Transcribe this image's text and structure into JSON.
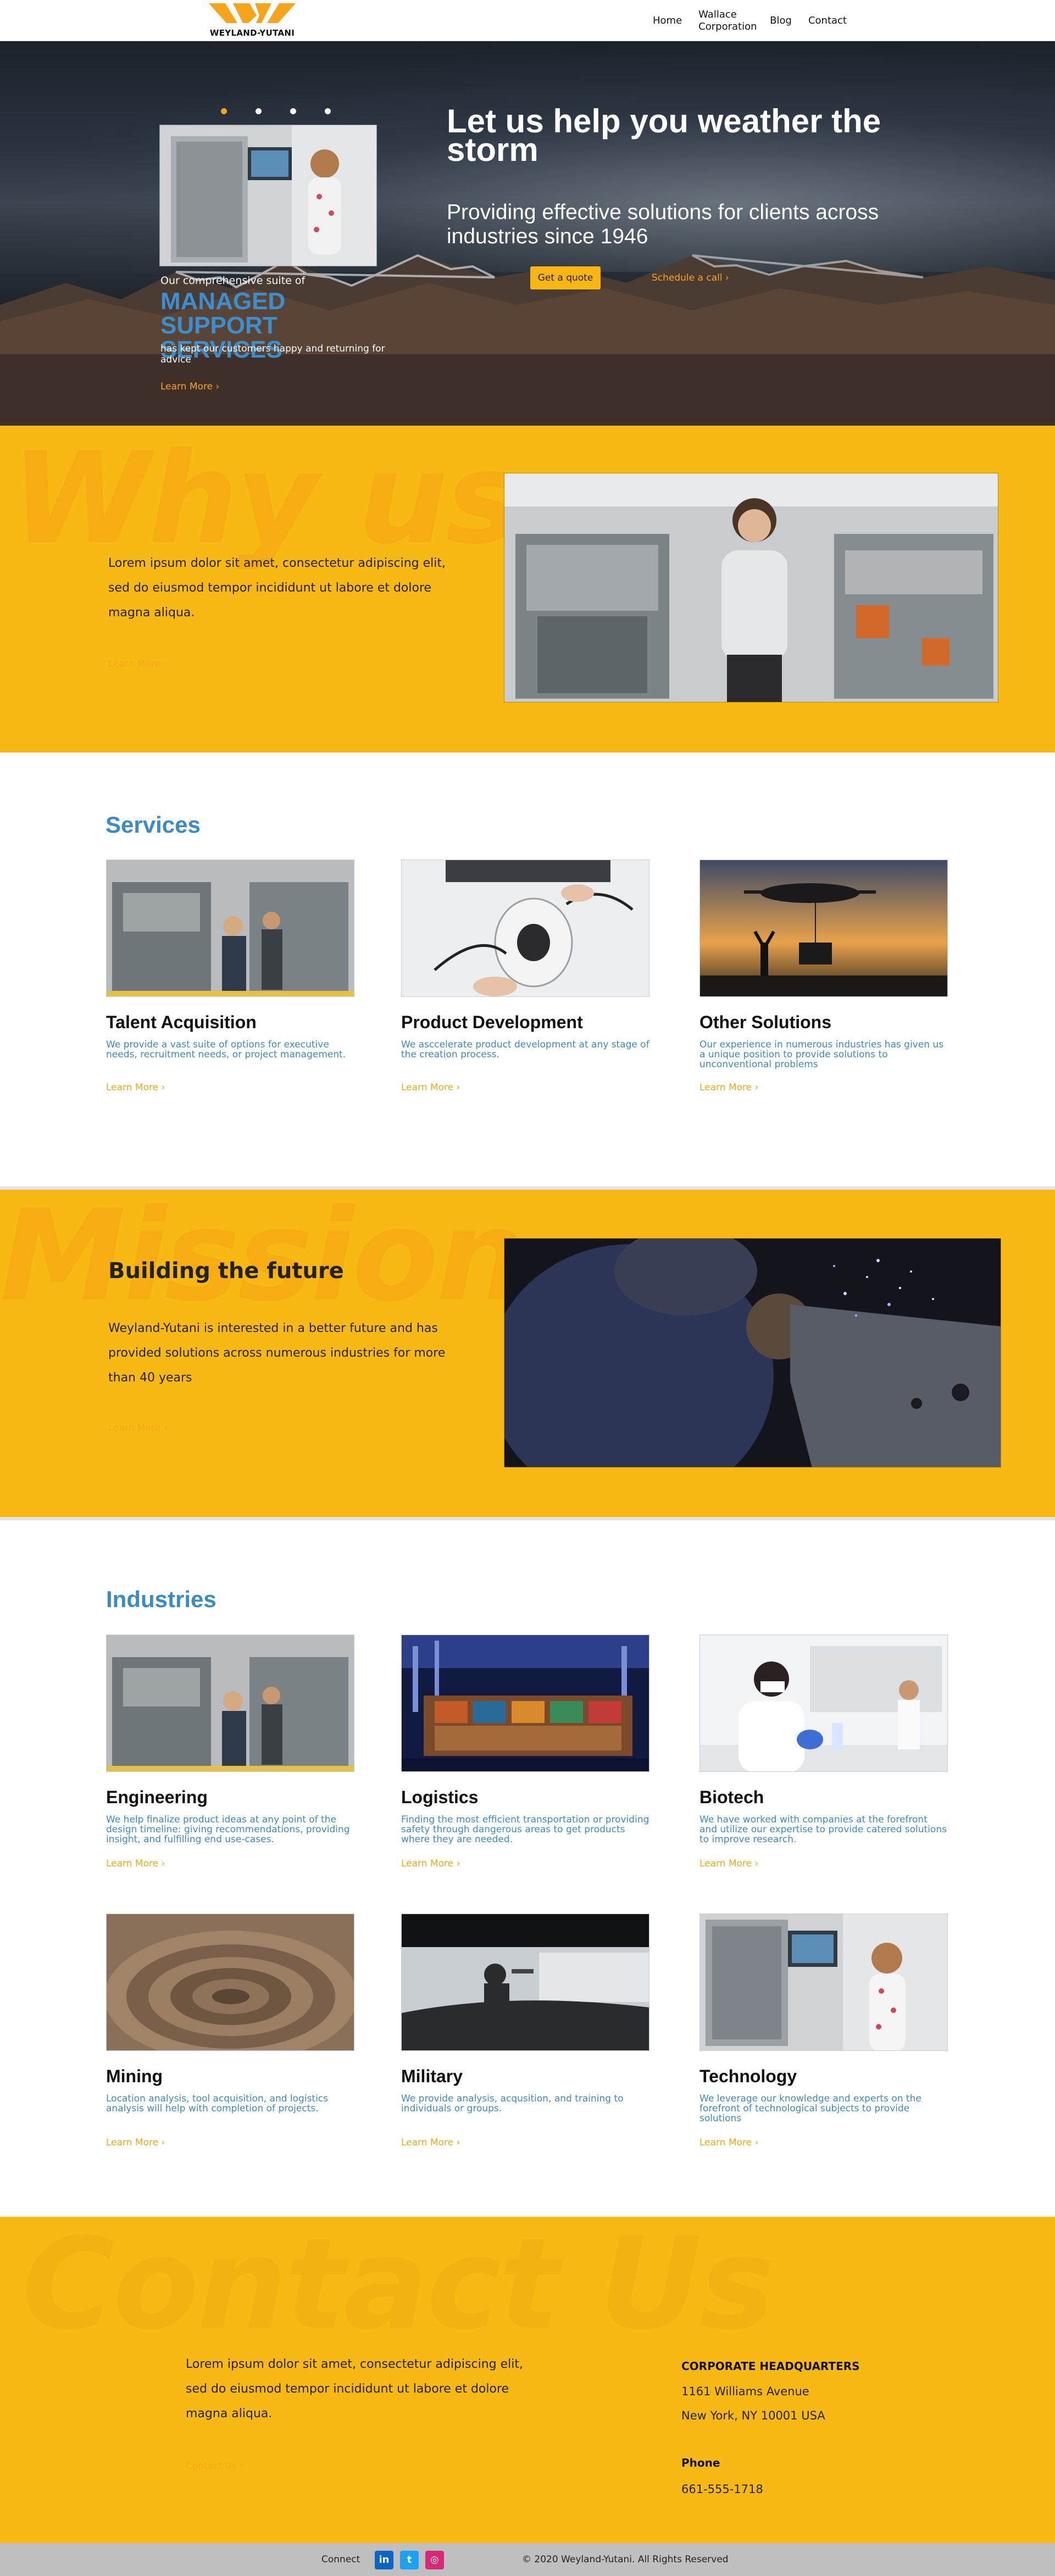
{
  "nav": {
    "logo_text": "WEYLAND-YUTANI",
    "links": [
      "Home",
      "Wallace Corporation",
      "Blog",
      "Contact"
    ]
  },
  "hero": {
    "slide_caption_top": "Our comprehensive suite of",
    "slide_highlight": "MANAGED SUPPORT SERVICES",
    "slide_caption_bottom": "has kept our customers happy and returning for advice",
    "slide_link": "Learn More",
    "title": "Let us help you weather the storm",
    "tagline": "Providing effective solutions for clients across industries since 1946",
    "quote_button": "Get a quote",
    "call_link": "Schedule a call"
  },
  "why_us": {
    "watermark": "Why us",
    "body": "Lorem ipsum dolor sit amet, consectetur adipiscing elit, sed do eiusmod tempor incididunt ut labore et dolore magna aliqua.",
    "link": "Learn More"
  },
  "services": {
    "title": "Services",
    "cards": [
      {
        "title": "Talent Acquisition",
        "desc": "We provide a vast suite of options for executive needs, recruitment needs, or project management.",
        "link": "Learn More"
      },
      {
        "title": "Product Development",
        "desc": "We asccelerate product development at any stage of the creation process.",
        "link": "Learn More"
      },
      {
        "title": "Other Solutions",
        "desc": "Our experience in numerous industries has given us a unique position to provide solutions to unconventional problems",
        "link": "Learn More"
      }
    ]
  },
  "mission": {
    "watermark": "Mission",
    "heading": "Building the future",
    "body": "Weyland-Yutani is interested in a better future and has provided solutions across numerous industries for more than 40 years",
    "link": "Learn More"
  },
  "industries": {
    "title": "Industries",
    "cards": [
      {
        "title": "Engineering",
        "desc": "We help finalize product ideas at any point of the design timeline: giving recommendations, providing insight, and fulfilling end use-cases.",
        "link": "Learn More"
      },
      {
        "title": "Logistics",
        "desc": "Finding the most efficient transportation or providing safety through dangerous areas to get products where they are needed.",
        "link": "Learn More"
      },
      {
        "title": "Biotech",
        "desc": "We have worked with companies at the forefront and utilize our expertise to provide catered solutions to improve research.",
        "link": "Learn More"
      },
      {
        "title": "Mining",
        "desc": "Location analysis, tool acquisition, and logistics analysis will help with completion of projects.",
        "link": "Learn More"
      },
      {
        "title": "Military",
        "desc": "We provide analysis, acqusition, and training to individuals or groups.",
        "link": "Learn More"
      },
      {
        "title": "Technology",
        "desc": "We leverage our knowledge and experts on the forefront of technological subjects to provide solutions",
        "link": "Learn More"
      }
    ]
  },
  "contact": {
    "watermark": "Contact Us",
    "body": "Lorem ipsum dolor sit amet, consectetur adipiscing elit, sed do eiusmod tempor incididunt ut labore et dolore magna aliqua.",
    "link": "Contact Us",
    "hq_title": "CORPORATE HEADQUARTERS",
    "hq_address1": "1161 Williams Avenue",
    "hq_address2": "New York, NY 10001 USA",
    "phone_title": "Phone",
    "phone": "661-555-1718"
  },
  "footer": {
    "connect": "Connect",
    "copyright": "© 2020 Weyland-Yutani. All Rights Reserved"
  },
  "colors": {
    "accent_yellow": "#f8b914",
    "link_orange": "#f5a813",
    "title_blue": "#3b8bc4"
  }
}
